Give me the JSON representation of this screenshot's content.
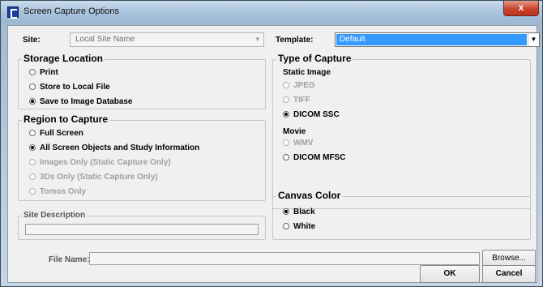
{
  "window": {
    "title": "Screen Capture Options",
    "close_glyph": "x"
  },
  "site": {
    "label": "Site:",
    "value": "Local Site Name"
  },
  "template": {
    "label": "Template:",
    "value": "Default"
  },
  "storage_location": {
    "title": "Storage Location",
    "options": [
      "Print",
      "Store to Local File",
      "Save to Image Database"
    ],
    "selected": "Save to Image Database"
  },
  "region_to_capture": {
    "title": "Region to Capture",
    "options": [
      "Full Screen",
      "All Screen Objects and Study Information",
      "Images Only (Static Capture Only)",
      "3Ds Only (Static Capture Only)",
      "Tomos Only"
    ],
    "selected": "All Screen Objects and Study Information",
    "disabled": [
      "Images Only (Static Capture Only)",
      "3Ds Only (Static Capture Only)",
      "Tomos Only"
    ]
  },
  "site_description": {
    "title": "Site Description",
    "value": ""
  },
  "type_of_capture": {
    "title": "Type of Capture",
    "static_label": "Static Image",
    "static_options": [
      "JPEG",
      "TIFF",
      "DICOM SSC"
    ],
    "movie_label": "Movie",
    "movie_options": [
      "WMV",
      "DICOM MFSC"
    ],
    "selected": "DICOM SSC",
    "disabled": [
      "JPEG",
      "TIFF",
      "WMV"
    ]
  },
  "canvas_color": {
    "title": "Canvas Color",
    "options": [
      "Black",
      "White"
    ],
    "selected": "Black"
  },
  "file_name": {
    "label": "File Name:",
    "value": ""
  },
  "buttons": {
    "browse": "Browse...",
    "ok": "OK",
    "cancel": "Cancel"
  },
  "icons": {
    "app_icon": "screen-capture-app-icon",
    "close_icon": "close-icon",
    "dropdown_icon": "chevron-down-icon"
  },
  "colors": {
    "selection": "#3399ff",
    "close_button": "#c9432c"
  }
}
